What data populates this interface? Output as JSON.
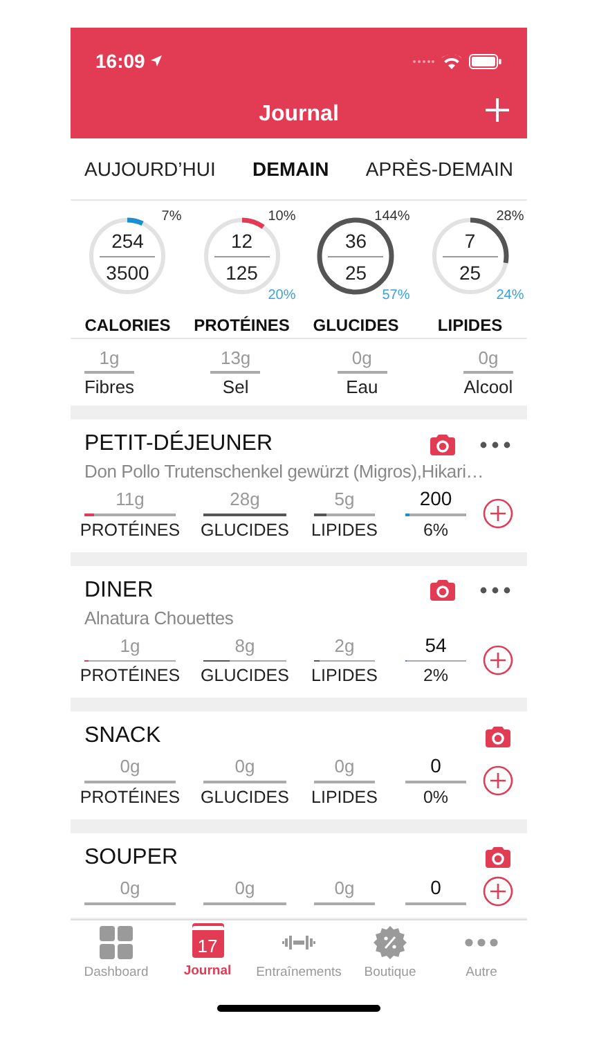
{
  "status_bar": {
    "time": "16:09"
  },
  "header": {
    "title": "Journal"
  },
  "day_tabs": [
    {
      "label": "AUJOURD’HUI",
      "selected": false
    },
    {
      "label": "DEMAIN",
      "selected": true
    },
    {
      "label": "APRÈS-DEMAIN",
      "selected": false
    }
  ],
  "rings": [
    {
      "label": "CALORIES",
      "value": "254",
      "goal": "3500",
      "top_percent": "7%",
      "level": 0.07,
      "color": "#1a8fd0"
    },
    {
      "label": "PROTÉINES",
      "value": "12",
      "goal": "125",
      "top_percent": "10%",
      "bottom_percent": "20%",
      "level": 0.1,
      "color": "#e23c55"
    },
    {
      "label": "GLUCIDES",
      "value": "36",
      "goal": "25",
      "top_percent": "144%",
      "bottom_percent": "57%",
      "level": 1,
      "color": "#555555"
    },
    {
      "label": "LIPIDES",
      "value": "7",
      "goal": "25",
      "top_percent": "28%",
      "bottom_percent": "24%",
      "level": 0.28,
      "color": "#555555"
    }
  ],
  "extras": [
    {
      "value": "1g",
      "label": "Fibres"
    },
    {
      "value": "13g",
      "label": "Sel"
    },
    {
      "value": "0g",
      "label": "Eau"
    },
    {
      "value": "0g",
      "label": "Alcool"
    }
  ],
  "meals": [
    {
      "title": "PETIT-DÉJEUNER",
      "description": "Don Pollo Trutenschenkel gewürzt (Migros),Hikari…",
      "menu": true,
      "macros": [
        {
          "value": "11g",
          "label": "PROTÉINES",
          "level": 0.1,
          "color": "#e23c55"
        },
        {
          "value": "28g",
          "label": "GLUCIDES",
          "level": 1,
          "color": "#555555"
        },
        {
          "value": "5g",
          "label": "LIPIDES",
          "level": 0.2,
          "color": "#555555"
        }
      ],
      "calories": {
        "value": "200",
        "percent": "6%",
        "level": 0.06
      }
    },
    {
      "title": "DINER",
      "description": "Alnatura Chouettes",
      "menu": true,
      "macros": [
        {
          "value": "1g",
          "label": "PROTÉINES",
          "level": 0.05,
          "color": "#e23c55"
        },
        {
          "value": "8g",
          "label": "GLUCIDES",
          "level": 0.32,
          "color": "#555555"
        },
        {
          "value": "2g",
          "label": "LIPIDES",
          "level": 0.1,
          "color": "#555555"
        }
      ],
      "calories": {
        "value": "54",
        "percent": "2%",
        "level": 0.02
      }
    },
    {
      "title": "SNACK",
      "macros": [
        {
          "value": "0g",
          "label": "PROTÉINES"
        },
        {
          "value": "0g",
          "label": "GLUCIDES"
        },
        {
          "value": "0g",
          "label": "LIPIDES"
        }
      ],
      "calories": {
        "value": "0",
        "percent": "0%"
      }
    },
    {
      "title": "SOUPER",
      "macros": [
        {
          "value": "0g"
        },
        {
          "value": "0g"
        },
        {
          "value": "0g"
        }
      ],
      "calories": {
        "value": "0"
      }
    }
  ],
  "tab_bar": [
    {
      "label": "Dashboard",
      "kind": "grid",
      "selected": false
    },
    {
      "label": "Journal",
      "kind": "calendar",
      "day": "17",
      "selected": true
    },
    {
      "label": "Entraînements",
      "kind": "dumbbell",
      "selected": false
    },
    {
      "label": "Boutique",
      "kind": "badge",
      "selected": false
    },
    {
      "label": "Autre",
      "kind": "more",
      "selected": false
    }
  ]
}
